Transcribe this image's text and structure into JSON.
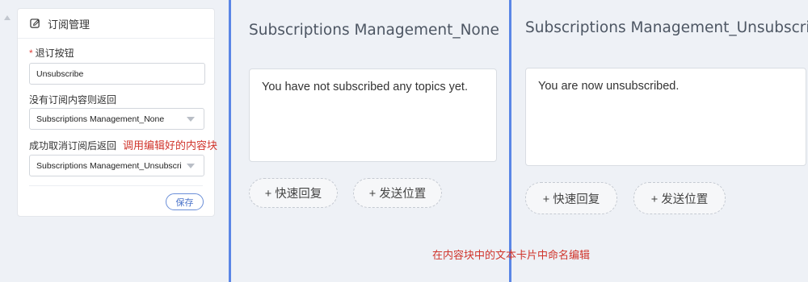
{
  "settings": {
    "title": "订阅管理",
    "unsubscribe_label": "退订按钮",
    "unsubscribe_required_mark": "*",
    "unsubscribe_value": "Unsubscribe",
    "none_label": "没有订阅内容则返回",
    "none_selected": "Subscriptions Management_None",
    "success_label": "成功取消订阅后返回",
    "success_selected": "Subscriptions Management_Unsubscribe",
    "save_label": "保存"
  },
  "annotations": {
    "call_block": "调用编辑好的内容块",
    "name_hint": "在内容块中的文本卡片中命名编辑"
  },
  "previews": [
    {
      "title": "Subscriptions Management_None",
      "message": "You have not subscribed any topics yet.",
      "buttons": [
        "+ 快速回复",
        "+ 发送位置"
      ]
    },
    {
      "title": "Subscriptions Management_Unsubscribe",
      "message": "You are now unsubscribed.",
      "buttons": [
        "+ 快速回复",
        "+ 发送位置"
      ]
    }
  ],
  "icons": {
    "header": "edit-icon",
    "collapse": "caret-up-icon",
    "select": "chevron-down-icon"
  },
  "colors": {
    "divider_line": "#5a86e6",
    "annotation": "#d0342b",
    "save_border": "#6b8fd8"
  }
}
